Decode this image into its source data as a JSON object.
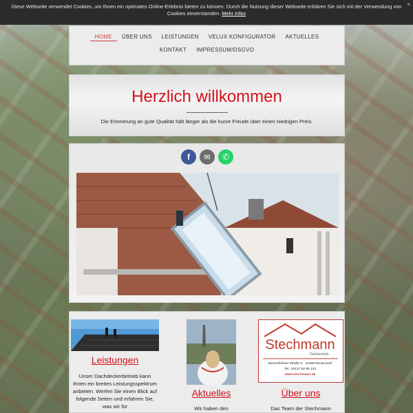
{
  "cookie": {
    "text": "Diese Webseite verwendet Cookies, um Ihnen ein optimales Online-Erlebnis bieten zu können. Durch die Nutzung dieser Webseite erklären Sie sich mit der Verwendung von Cookies einverstanden.",
    "link": "Mehr Infos",
    "close": "×"
  },
  "nav": {
    "items": [
      "HOME",
      "ÜBER UNS",
      "LEISTUNGEN",
      "VELUX KONFIGURATOR",
      "AKTUELLES",
      "KONTAKT",
      "IMPRESSUM/DSGVO"
    ]
  },
  "hero": {
    "title": "Herzlich willkommen",
    "subtitle": "Die Erinnerung an gute Qualität hält länger als die kurze Freude über einen niedrigen Preis."
  },
  "share": {
    "facebook": "f",
    "email": "✉",
    "whatsapp": "✆"
  },
  "columns": [
    {
      "title": "Leistungen",
      "text": "Unser Dachdeckerbetrieb kann Ihnen ein breites Leistungsspektrum anbieten. Werfen Sie einen Blick auf folgende Seiten und erfahren Sie, was wir für"
    },
    {
      "title": "Aktuelles",
      "text": "Wir haben den"
    },
    {
      "title": "Über uns",
      "text": "Das Team der Stechmann"
    }
  ],
  "logo": {
    "name": "Stechmann",
    "tagline": "Dachtechnik",
    "address": "Nievenheimer Straße 9 · 41469 Neuss-Norf",
    "phone": "Tel.: 02137 92 80 124",
    "web": "www.stechmann.de"
  },
  "colors": {
    "accent": "#d4121a",
    "facebook": "#3b5998",
    "email": "#6d6d6d",
    "whatsapp": "#25d366"
  }
}
